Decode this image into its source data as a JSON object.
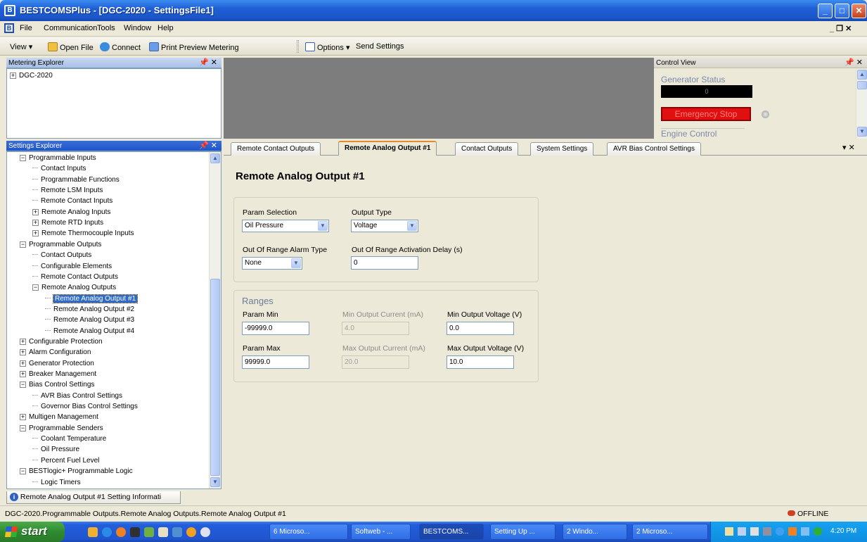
{
  "window": {
    "app_icon": "B",
    "title": "BESTCOMSPlus - [DGC-2020 - SettingsFile1]",
    "min": "_",
    "max": "□",
    "close": "✕"
  },
  "menu": {
    "doc_icon": "B",
    "items": [
      "File",
      "Communication",
      "Tools",
      "Window",
      "Help"
    ],
    "right_controls": "_ ❐ ✕"
  },
  "toolbar": {
    "view": "View",
    "open_file": "Open File",
    "connect": "Connect",
    "print_preview": "Print Preview Metering",
    "options": "Options",
    "send_settings": "Send Settings",
    "dropdown": "▾"
  },
  "metering_explorer": {
    "title": "Metering Explorer",
    "controls": "📌 ✕",
    "items": [
      "DGC-2020"
    ],
    "expander": "+"
  },
  "control_view": {
    "title": "Control View",
    "controls": "📌 ✕",
    "gen_status_label": "Generator Status",
    "gen_status_value": "0",
    "estop": "Emergency Stop",
    "engine_control": "Engine Control"
  },
  "settings_explorer": {
    "title": "Settings Explorer",
    "controls": "📌 ✕",
    "items": [
      {
        "label": "Programmable Inputs",
        "exp": "−"
      },
      {
        "label": "Contact Inputs"
      },
      {
        "label": "Programmable Functions"
      },
      {
        "label": "Remote LSM Inputs"
      },
      {
        "label": "Remote Contact Inputs"
      },
      {
        "label": "Remote Analog Inputs",
        "exp": "+"
      },
      {
        "label": "Remote RTD Inputs",
        "exp": "+"
      },
      {
        "label": "Remote Thermocouple Inputs",
        "exp": "+"
      },
      {
        "label": "Programmable Outputs",
        "exp": "−"
      },
      {
        "label": "Contact Outputs"
      },
      {
        "label": "Configurable Elements"
      },
      {
        "label": "Remote Contact Outputs"
      },
      {
        "label": "Remote Analog Outputs",
        "exp": "−"
      },
      {
        "label": "Remote Analog Output #1",
        "selected": true
      },
      {
        "label": "Remote Analog Output #2"
      },
      {
        "label": "Remote Analog Output #3"
      },
      {
        "label": "Remote Analog Output #4"
      },
      {
        "label": "Configurable Protection",
        "exp": "+"
      },
      {
        "label": "Alarm Configuration",
        "exp": "+"
      },
      {
        "label": "Generator Protection",
        "exp": "+"
      },
      {
        "label": "Breaker Management",
        "exp": "+"
      },
      {
        "label": "Bias Control Settings",
        "exp": "−"
      },
      {
        "label": "AVR Bias Control Settings"
      },
      {
        "label": "Governor Bias Control Settings"
      },
      {
        "label": "Multigen Management",
        "exp": "+"
      },
      {
        "label": "Programmable Senders",
        "exp": "−"
      },
      {
        "label": "Coolant Temperature"
      },
      {
        "label": "Oil Pressure"
      },
      {
        "label": "Percent Fuel Level"
      },
      {
        "label": "BESTlogic+ Programmable Logic",
        "exp": "−"
      },
      {
        "label": "Logic Timers"
      }
    ]
  },
  "info_tab": {
    "icon": "i",
    "label": "Remote Analog Output #1 Setting Informati"
  },
  "tabs": {
    "items": [
      "Remote Contact Outputs",
      "Remote Analog Output #1",
      "Contact Outputs",
      "System Settings",
      "AVR Bias Control Settings"
    ],
    "controls": "▾ ✕"
  },
  "form": {
    "heading": "Remote Analog Output #1",
    "param_selection_label": "Param Selection",
    "param_selection_value": "Oil Pressure",
    "output_type_label": "Output Type",
    "output_type_value": "Voltage",
    "oor_alarm_label": "Out Of Range Alarm Type",
    "oor_alarm_value": "None",
    "oor_delay_label": "Out Of Range Activation Delay (s)",
    "oor_delay_value": "0",
    "arrow": "▼",
    "ranges_title": "Ranges",
    "param_min_label": "Param Min",
    "param_min_value": "-99999.0",
    "min_current_label": "Min Output Current (mA)",
    "min_current_value": "4.0",
    "min_voltage_label": "Min Output Voltage (V)",
    "min_voltage_value": "0.0",
    "param_max_label": "Param Max",
    "param_max_value": "99999.0",
    "max_current_label": "Max Output Current (mA)",
    "max_current_value": "20.0",
    "max_voltage_label": "Max Output Voltage (V)",
    "max_voltage_value": "10.0"
  },
  "status": {
    "path": "DGC-2020.Programmable Outputs.Remote Analog Outputs.Remote Analog Output #1",
    "connection": "OFFLINE"
  },
  "taskbar": {
    "start": "start",
    "tasks": [
      "6 Microso...",
      "Softweb - ...",
      "BESTCOMS...",
      "Setting Up ...",
      "2 Windo...",
      "2 Microso..."
    ],
    "time": "4:20 PM"
  },
  "colors": {
    "estop": "#e01010",
    "selection": "#316ac5",
    "title_blue": "#1f5fd6"
  }
}
